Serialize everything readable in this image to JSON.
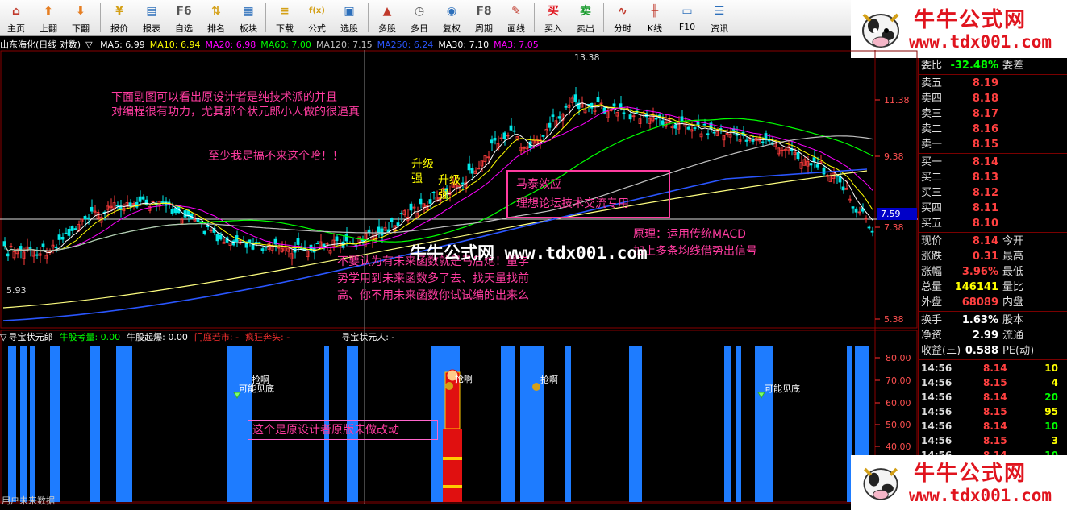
{
  "toolbar": [
    {
      "label": "主页",
      "icon": "home-icon",
      "glyph": "⌂",
      "color": "#c0392b"
    },
    {
      "label": "上翻",
      "icon": "up-arrow-icon",
      "glyph": "⬆",
      "color": "#e67e22"
    },
    {
      "label": "下翻",
      "icon": "down-arrow-icon",
      "glyph": "⬇",
      "color": "#e67e22"
    },
    {
      "label": "报价",
      "icon": "quote-icon",
      "glyph": "¥",
      "color": "#d4a017"
    },
    {
      "label": "报表",
      "icon": "report-icon",
      "glyph": "▤",
      "color": "#2c6fbb"
    },
    {
      "label": "自选",
      "icon": "f6-icon",
      "glyph": "F6",
      "color": "#555"
    },
    {
      "label": "排名",
      "icon": "rank-icon",
      "glyph": "⇅",
      "color": "#d4a017"
    },
    {
      "label": "板块",
      "icon": "sector-icon",
      "glyph": "▦",
      "color": "#2c6fbb"
    },
    {
      "label": "下载",
      "icon": "download-icon",
      "glyph": "≡",
      "color": "#d4a017"
    },
    {
      "label": "公式",
      "icon": "formula-icon",
      "glyph": "f(x)",
      "color": "#d4a017"
    },
    {
      "label": "选股",
      "icon": "stock-pick-icon",
      "glyph": "▣",
      "color": "#2c6fbb"
    },
    {
      "label": "多股",
      "icon": "multi-stock-icon",
      "glyph": "▲",
      "color": "#c0392b"
    },
    {
      "label": "多日",
      "icon": "multi-day-icon",
      "glyph": "◷",
      "color": "#555"
    },
    {
      "label": "复权",
      "icon": "restore-icon",
      "glyph": "◉",
      "color": "#2c6fbb"
    },
    {
      "label": "周期",
      "icon": "f8-icon",
      "glyph": "F8",
      "color": "#555"
    },
    {
      "label": "画线",
      "icon": "draw-line-icon",
      "glyph": "✎",
      "color": "#c0392b"
    },
    {
      "label": "买入",
      "icon": "buy-icon",
      "glyph": "买",
      "color": "#e0141e"
    },
    {
      "label": "卖出",
      "icon": "sell-icon",
      "glyph": "卖",
      "color": "#159a2a"
    },
    {
      "label": "分时",
      "icon": "intraday-icon",
      "glyph": "∿",
      "color": "#c0392b"
    },
    {
      "label": "K线",
      "icon": "kline-icon",
      "glyph": "╫",
      "color": "#c0392b"
    },
    {
      "label": "F10",
      "icon": "f10-icon",
      "glyph": "▭",
      "color": "#2c6fbb"
    },
    {
      "label": "资讯",
      "icon": "news-icon",
      "glyph": "☰",
      "color": "#2c6fbb"
    }
  ],
  "brand": {
    "name": "牛牛公式网",
    "url": "www.tdx001.com"
  },
  "chart_header": {
    "title": "山东海化(日线 对数)",
    "ma": [
      {
        "label": "MA5: 6.99",
        "color": "#ffffff"
      },
      {
        "label": "MA10: 6.94",
        "color": "#ffff00"
      },
      {
        "label": "MA20: 6.98",
        "color": "#ff00ff"
      },
      {
        "label": "MA60: 7.00",
        "color": "#00ff00"
      },
      {
        "label": "MA120: 7.15",
        "color": "#c0c0c0"
      },
      {
        "label": "MA250: 6.24",
        "color": "#2a56ff"
      },
      {
        "label": "MA30: 7.10",
        "color": "#ffffff"
      },
      {
        "label": "MA3: 7.05",
        "color": "#ff00ff"
      }
    ]
  },
  "price_axis": [
    "11.38",
    "9.38",
    "7.38",
    "5.38"
  ],
  "price_marker": "7.59",
  "chart_labels": {
    "high": "13.38",
    "low": "5.93"
  },
  "annotations": {
    "a1": "下面副图可以看出原设计者是纯技术派的并且",
    "a2": "对编程很有功力，尤其那个状元郎小人做的很逼真",
    "a3": "至少我是搞不来这个哈！！",
    "up1": "升级",
    "up1b": "强",
    "up2": "升级",
    "up2b": "强",
    "box1": "马泰效应",
    "box2": "理想论坛技术交流专用",
    "p1": "原理：运用传统MACD",
    "p2": "加上多条均线借势出信号",
    "n1": "不要认为有未来函数就是马后炮！量学",
    "n2": "势学用到未来函数多了去、找天量找前",
    "n3": "高、你不用未来函数你试试编的出来么",
    "watermark": "牛牛公式网  www.tdx001.com",
    "sub_note": "这个是原设计者原版未做改动"
  },
  "sub_header": [
    {
      "label": "寻宝状元郎",
      "color": "#ffffff"
    },
    {
      "label": "牛股考量: 0.00",
      "color": "#00ff00"
    },
    {
      "label": "牛股起爆: 0.00",
      "color": "#ffffff"
    },
    {
      "label": "门庭若市: -",
      "color": "#ff3030"
    },
    {
      "label": "疯狂奔头: -",
      "color": "#ff3030"
    },
    {
      "label": "寻宝状元人: -",
      "color": "#ffffff"
    }
  ],
  "sub_axis": [
    "80.00",
    "70.00",
    "60.00",
    "50.00",
    "40.00"
  ],
  "sub_labels": {
    "grab1": "抢啊",
    "maybe1": "可能见底",
    "grab2": "抢啊",
    "grab3": "抢啊",
    "maybe2": "可能见底"
  },
  "bottom_note": "用户未来数据",
  "right_panel": {
    "wei": {
      "label": "委比",
      "value": "-32.48%",
      "label2": "委差"
    },
    "asks": [
      {
        "label": "卖五",
        "price": "8.19"
      },
      {
        "label": "卖四",
        "price": "8.18"
      },
      {
        "label": "卖三",
        "price": "8.17"
      },
      {
        "label": "卖二",
        "price": "8.16"
      },
      {
        "label": "卖一",
        "price": "8.15"
      }
    ],
    "bids": [
      {
        "label": "买一",
        "price": "8.14"
      },
      {
        "label": "买二",
        "price": "8.13"
      },
      {
        "label": "买三",
        "price": "8.12"
      },
      {
        "label": "买四",
        "price": "8.11"
      },
      {
        "label": "买五",
        "price": "8.10"
      }
    ],
    "quote": [
      {
        "label": "现价",
        "value": "8.14",
        "label2": "今开",
        "color": "#ff4040"
      },
      {
        "label": "涨跌",
        "value": "0.31",
        "label2": "最高",
        "color": "#ff4040"
      },
      {
        "label": "涨幅",
        "value": "3.96%",
        "label2": "最低",
        "color": "#ff4040"
      },
      {
        "label": "总量",
        "value": "146141",
        "label2": "量比",
        "color": "#ffff00"
      },
      {
        "label": "外盘",
        "value": "68089",
        "label2": "内盘",
        "color": "#ff4040"
      }
    ],
    "fund": [
      {
        "label": "换手",
        "value": "1.63%",
        "label2": "股本",
        "color": "#ffffff"
      },
      {
        "label": "净资",
        "value": "2.99",
        "label2": "流通",
        "color": "#ffffff"
      },
      {
        "label": "收益(三)",
        "value": "0.588",
        "label2": "PE(动)",
        "color": "#ffffff"
      }
    ],
    "ticks": [
      {
        "time": "14:56",
        "price": "8.14",
        "vol": "10",
        "pc": "#ff4040",
        "vc": "#ffff00"
      },
      {
        "time": "14:56",
        "price": "8.15",
        "vol": "4",
        "pc": "#ff4040",
        "vc": "#ffff00"
      },
      {
        "time": "14:56",
        "price": "8.14",
        "vol": "20",
        "pc": "#ff4040",
        "vc": "#00ff00"
      },
      {
        "time": "14:56",
        "price": "8.15",
        "vol": "95",
        "pc": "#ff4040",
        "vc": "#ffff00"
      },
      {
        "time": "14:56",
        "price": "8.14",
        "vol": "10",
        "pc": "#ff4040",
        "vc": "#00ff00"
      },
      {
        "time": "14:56",
        "price": "8.15",
        "vol": "3",
        "pc": "#ff4040",
        "vc": "#ffff00"
      },
      {
        "time": "14:56",
        "price": "8.14",
        "vol": "10",
        "pc": "#ff4040",
        "vc": "#00ff00"
      }
    ]
  }
}
